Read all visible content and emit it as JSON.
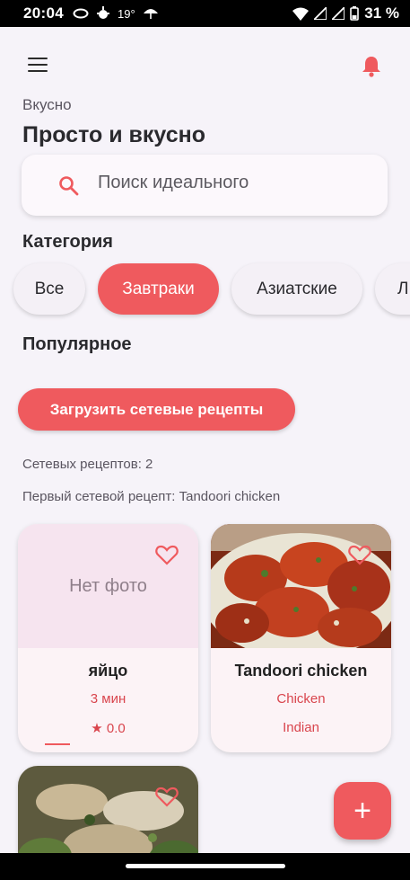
{
  "status_bar": {
    "time": "20:04",
    "temperature": "19°",
    "battery": "31 %",
    "icons": [
      "cloud-icon",
      "weather-icon",
      "umbrella-icon",
      "wifi-icon",
      "signal-icon",
      "battery-icon"
    ]
  },
  "header": {
    "subtitle": "Вкусно",
    "title": "Просто и вкусно"
  },
  "search": {
    "placeholder": "Поиск идеального"
  },
  "categories": {
    "heading": "Категория",
    "items": [
      "Все",
      "Завтраки",
      "Азиатские",
      "Л"
    ],
    "active_index": 1
  },
  "popular": {
    "heading": "Популярное"
  },
  "load_button": "Загрузить сетевые рецепты",
  "network": {
    "count_text": "Сетевых рецептов: 2",
    "first_text": "Первый сетевой рецепт: Tandoori chicken"
  },
  "recipes": [
    {
      "no_photo": "Нет фото",
      "name": "яйцо",
      "time": "3 мин",
      "rating": "★ 0.0"
    },
    {
      "name": "Tandoori chicken",
      "category": "Chicken",
      "area": "Indian"
    }
  ],
  "fab": "+",
  "colors": {
    "accent": "#ef5a5e",
    "background": "#f6f3f9",
    "meta_text": "#d9454d"
  }
}
